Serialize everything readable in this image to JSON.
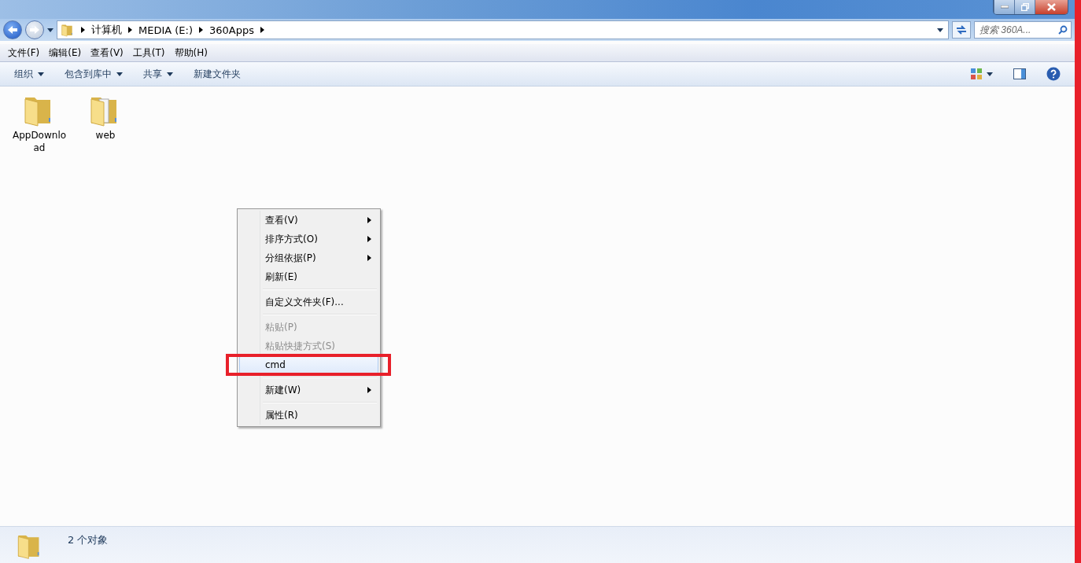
{
  "address_bar": {
    "breadcrumbs": [
      "计算机",
      "MEDIA (E:)",
      "360Apps"
    ]
  },
  "search": {
    "placeholder": "搜索 360A..."
  },
  "window_controls": [
    {
      "kind": "minimize"
    },
    {
      "kind": "restore"
    },
    {
      "kind": "close"
    }
  ],
  "menu_bar": [
    "文件(F)",
    "编辑(E)",
    "查看(V)",
    "工具(T)",
    "帮助(H)"
  ],
  "toolbar": [
    {
      "label": "组织",
      "dropdown": true
    },
    {
      "label": "包含到库中",
      "dropdown": true
    },
    {
      "label": "共享",
      "dropdown": true
    },
    {
      "label": "新建文件夹",
      "dropdown": false
    }
  ],
  "files": [
    {
      "name": "AppDownload",
      "kind": "empty"
    },
    {
      "name": "web",
      "kind": "full"
    }
  ],
  "context_menu": [
    {
      "kind": "item",
      "label": "查看(V)",
      "submenu": true,
      "disabled": false,
      "selected": false,
      "annotated": false
    },
    {
      "kind": "item",
      "label": "排序方式(O)",
      "submenu": true,
      "disabled": false,
      "selected": false,
      "annotated": false
    },
    {
      "kind": "item",
      "label": "分组依据(P)",
      "submenu": true,
      "disabled": false,
      "selected": false,
      "annotated": false
    },
    {
      "kind": "item",
      "label": "刷新(E)",
      "submenu": false,
      "disabled": false,
      "selected": false,
      "annotated": false
    },
    {
      "kind": "separator"
    },
    {
      "kind": "item",
      "label": "自定义文件夹(F)...",
      "submenu": false,
      "disabled": false,
      "selected": false,
      "annotated": false
    },
    {
      "kind": "separator"
    },
    {
      "kind": "item",
      "label": "粘贴(P)",
      "submenu": false,
      "disabled": true,
      "selected": false,
      "annotated": false
    },
    {
      "kind": "item",
      "label": "粘贴快捷方式(S)",
      "submenu": false,
      "disabled": true,
      "selected": false,
      "annotated": false
    },
    {
      "kind": "item",
      "label": "cmd",
      "submenu": false,
      "disabled": false,
      "selected": true,
      "annotated": true
    },
    {
      "kind": "separator"
    },
    {
      "kind": "item",
      "label": "新建(W)",
      "submenu": true,
      "disabled": false,
      "selected": false,
      "annotated": false
    },
    {
      "kind": "separator"
    },
    {
      "kind": "item",
      "label": "属性(R)",
      "submenu": false,
      "disabled": false,
      "selected": false,
      "annotated": false
    }
  ],
  "status_bar": {
    "text": "2 个对象"
  }
}
